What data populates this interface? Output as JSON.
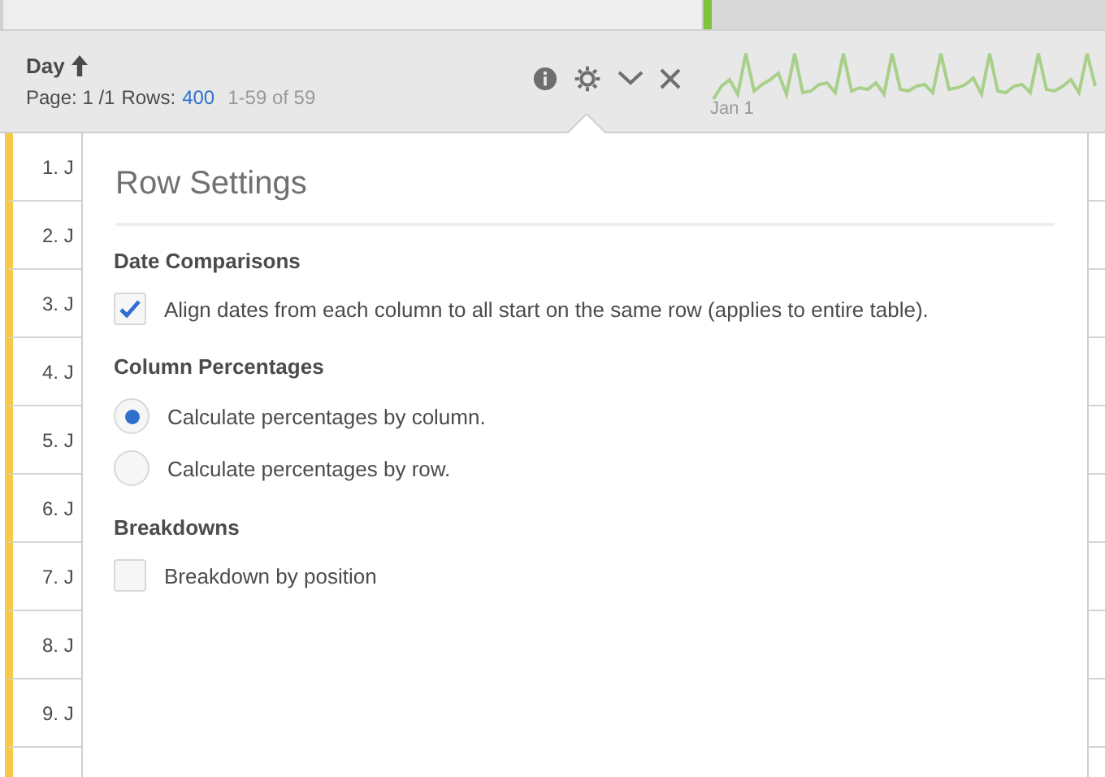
{
  "header": {
    "title": "Day",
    "page_label": "Page: 1 /1",
    "rows_label": "Rows:",
    "rows_value": "400",
    "range": "1-59 of 59",
    "sparkline_label": "Jan 1"
  },
  "rows": [
    {
      "label": "1. J"
    },
    {
      "label": "2. J"
    },
    {
      "label": "3. J"
    },
    {
      "label": "4. J"
    },
    {
      "label": "5. J"
    },
    {
      "label": "6. J"
    },
    {
      "label": "7. J"
    },
    {
      "label": "8. J"
    },
    {
      "label": "9. J"
    }
  ],
  "popup": {
    "title": "Row Settings",
    "sections": [
      {
        "heading": "Date Comparisons",
        "options": [
          {
            "kind": "checkbox",
            "label": "Align dates from each column to all start on the same row (applies to entire table).",
            "checked": true
          }
        ]
      },
      {
        "heading": "Column Percentages",
        "options": [
          {
            "kind": "radio",
            "label": "Calculate percentages by column.",
            "selected": true
          },
          {
            "kind": "radio",
            "label": "Calculate percentages by row.",
            "selected": false
          }
        ]
      },
      {
        "heading": "Breakdowns",
        "options": [
          {
            "kind": "checkbox",
            "label": "Breakdown by position",
            "checked": false
          }
        ]
      }
    ]
  }
}
